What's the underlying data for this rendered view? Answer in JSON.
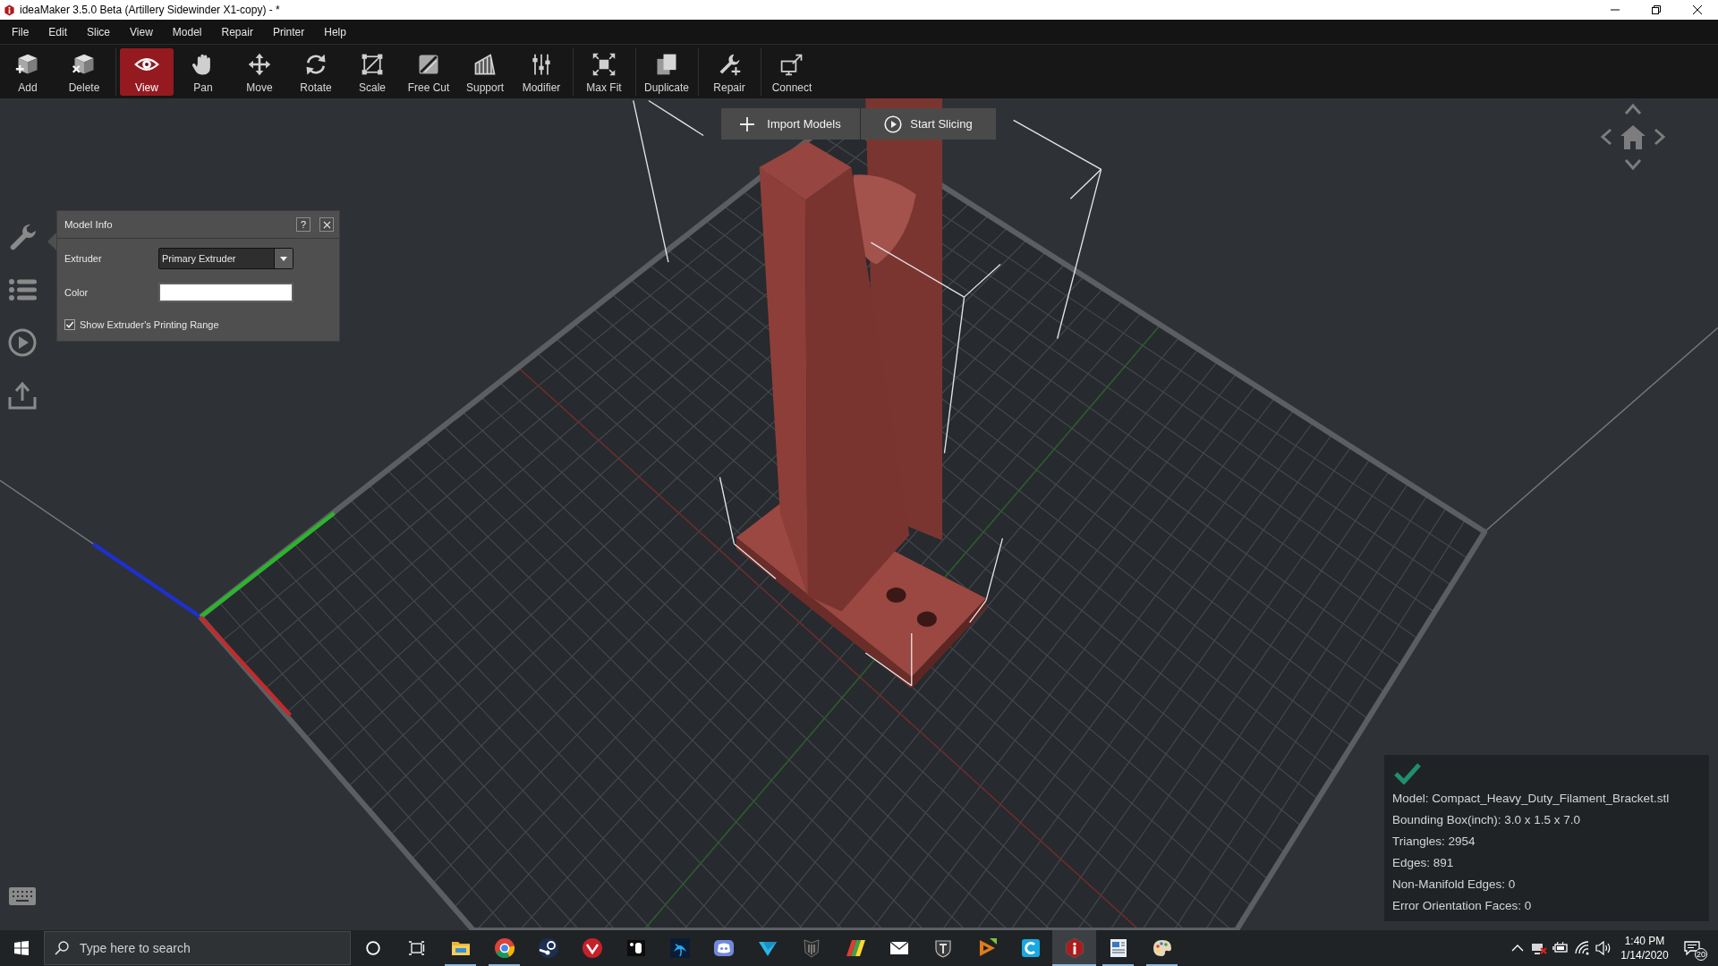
{
  "window": {
    "title": "ideaMaker 3.5.0 Beta (Artillery Sidewinder X1-copy) - *"
  },
  "menu": [
    "File",
    "Edit",
    "Slice",
    "View",
    "Model",
    "Repair",
    "Printer",
    "Help"
  ],
  "toolbar": {
    "groups": [
      {
        "tools": [
          {
            "label": "Add",
            "selected": false
          },
          {
            "label": "Delete",
            "selected": false
          }
        ]
      },
      {
        "tools": [
          {
            "label": "View",
            "selected": true
          },
          {
            "label": "Pan",
            "selected": false
          },
          {
            "label": "Move",
            "selected": false
          },
          {
            "label": "Rotate",
            "selected": false
          },
          {
            "label": "Scale",
            "selected": false
          },
          {
            "label": "Free Cut",
            "selected": false
          },
          {
            "label": "Support",
            "selected": false
          },
          {
            "label": "Modifier",
            "selected": false
          }
        ]
      },
      {
        "tools": [
          {
            "label": "Max Fit",
            "selected": false
          }
        ]
      },
      {
        "tools": [
          {
            "label": "Duplicate",
            "selected": false
          }
        ]
      },
      {
        "tools": [
          {
            "label": "Repair",
            "selected": false
          }
        ]
      },
      {
        "tools": [
          {
            "label": "Connect",
            "selected": false
          }
        ]
      }
    ]
  },
  "viewport_actions": [
    {
      "label": "Import Models"
    },
    {
      "label": "Start Slicing"
    }
  ],
  "model_info": {
    "title": "Model Info",
    "help": "?",
    "extruder": {
      "label": "Extruder",
      "value": "Primary Extruder"
    },
    "color": {
      "label": "Color",
      "color": "#ffffff"
    },
    "show_range": {
      "label": "Show Extruder's Printing Range",
      "checked": true
    }
  },
  "model_stats": {
    "valid": true,
    "lines": [
      "Model: Compact_Heavy_Duty_Filament_Bracket.stl",
      "Bounding Box(inch): 3.0 x 1.5 x 7.0",
      "Triangles: 2954",
      "Edges: 891",
      "Non-Manifold Edges: 0",
      "Error Orientation Faces: 0"
    ]
  },
  "taskbar": {
    "search": {
      "placeholder": "Type here to search"
    },
    "apps": [
      {
        "running": true,
        "selected": false
      },
      {
        "running": true,
        "selected": false
      },
      {
        "running": false,
        "selected": false
      },
      {
        "running": false,
        "selected": false
      },
      {
        "running": false,
        "selected": false
      },
      {
        "running": false,
        "selected": false
      },
      {
        "running": false,
        "selected": false
      },
      {
        "running": false,
        "selected": false
      },
      {
        "running": false,
        "selected": false
      },
      {
        "running": false,
        "selected": false
      },
      {
        "running": false,
        "selected": false
      },
      {
        "running": false,
        "selected": false
      },
      {
        "running": false,
        "selected": false
      },
      {
        "running": false,
        "selected": false
      },
      {
        "running": true,
        "selected": true
      },
      {
        "running": true,
        "selected": false
      },
      {
        "running": true,
        "selected": false
      }
    ],
    "clock": {
      "time": "1:40 PM",
      "date": "1/14/2020"
    },
    "notifications": "20"
  }
}
